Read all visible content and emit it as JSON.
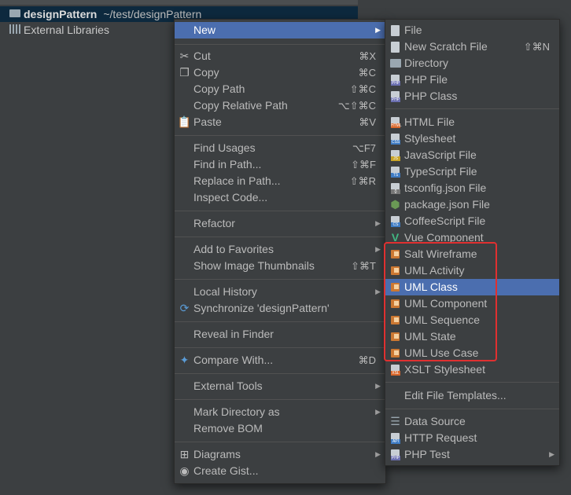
{
  "project_tree": {
    "root_name": "designPattern",
    "root_path": "~/test/designPattern",
    "libraries": "External Libraries"
  },
  "main_menu": {
    "new": "New",
    "cut": {
      "label": "Cut",
      "shortcut": "⌘X"
    },
    "copy": {
      "label": "Copy",
      "shortcut": "⌘C"
    },
    "copy_path": {
      "label": "Copy Path",
      "shortcut": "⇧⌘C"
    },
    "copy_relative_path": {
      "label": "Copy Relative Path",
      "shortcut": "⌥⇧⌘C"
    },
    "paste": {
      "label": "Paste",
      "shortcut": "⌘V"
    },
    "find_usages": {
      "label": "Find Usages",
      "shortcut": "⌥F7"
    },
    "find_in_path": {
      "label": "Find in Path...",
      "shortcut": "⇧⌘F"
    },
    "replace_in_path": {
      "label": "Replace in Path...",
      "shortcut": "⇧⌘R"
    },
    "inspect_code": "Inspect Code...",
    "refactor": "Refactor",
    "add_to_favorites": "Add to Favorites",
    "show_image_thumbnails": {
      "label": "Show Image Thumbnails",
      "shortcut": "⇧⌘T"
    },
    "local_history": "Local History",
    "synchronize": "Synchronize 'designPattern'",
    "reveal_in_finder": "Reveal in Finder",
    "compare_with": {
      "label": "Compare With...",
      "shortcut": "⌘D"
    },
    "external_tools": "External Tools",
    "mark_directory_as": "Mark Directory as",
    "remove_bom": "Remove BOM",
    "diagrams": "Diagrams",
    "create_gist": "Create Gist..."
  },
  "new_submenu": {
    "file": "File",
    "new_scratch_file": {
      "label": "New Scratch File",
      "shortcut": "⇧⌘N"
    },
    "directory": "Directory",
    "php_file": "PHP File",
    "php_class": "PHP Class",
    "html_file": "HTML File",
    "stylesheet": "Stylesheet",
    "javascript_file": "JavaScript File",
    "typescript_file": "TypeScript File",
    "tsconfig_json_file": "tsconfig.json File",
    "package_json_file": "package.json File",
    "coffeescript_file": "CoffeeScript File",
    "vue_component": "Vue Component",
    "salt_wireframe": "Salt Wireframe",
    "uml_activity": "UML Activity",
    "uml_class": "UML Class",
    "uml_component": "UML Component",
    "uml_sequence": "UML Sequence",
    "uml_state": "UML State",
    "uml_use_case": "UML Use Case",
    "xslt_stylesheet": "XSLT Stylesheet",
    "edit_file_templates": "Edit File Templates...",
    "data_source": "Data Source",
    "http_request": "HTTP Request",
    "php_test": "PHP Test"
  },
  "colors": {
    "selection": "#4b6eaf",
    "highlight_box": "#e03030",
    "background": "#3c3f41"
  },
  "state": {
    "main_selected": "New",
    "sub_selected": "UML Class"
  }
}
